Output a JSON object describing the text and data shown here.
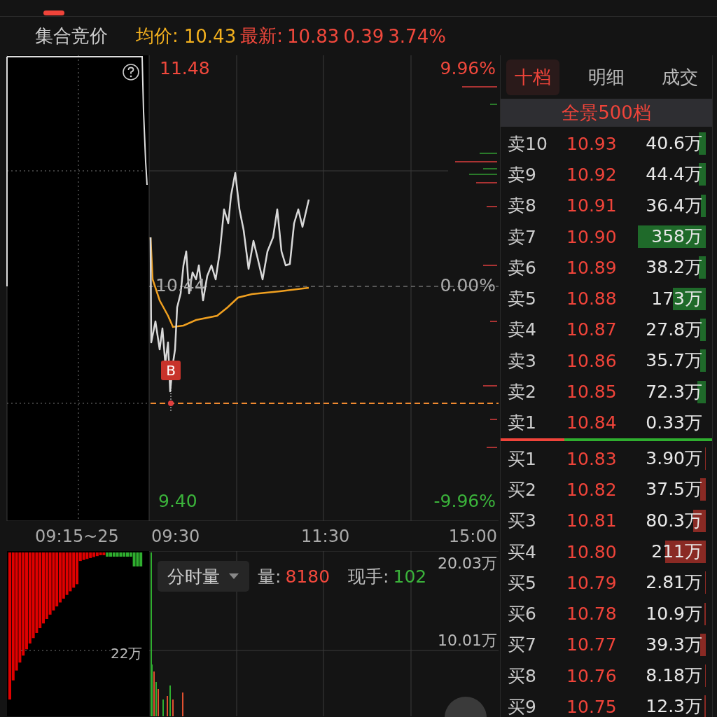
{
  "header": {
    "mode": "集合竞价",
    "avg_label": "均价:",
    "avg_price": "10.43",
    "last_label": "最新:",
    "last_price": "10.83",
    "change": "0.39",
    "change_pct": "3.74%"
  },
  "price_chart": {
    "high": "11.48",
    "high_pct": "9.96%",
    "mid": "10.44",
    "mid_pct": "0.00%",
    "low": "9.40",
    "low_pct": "-9.96%",
    "marker": "B"
  },
  "time_axis": [
    "09:15~25",
    "09:30",
    "11:30",
    "15:00"
  ],
  "volume_chart": {
    "selector": "分时量",
    "volume_label": "量:",
    "volume_value": "8180",
    "hand_label": "现手:",
    "hand_value": "102",
    "top_tick": "20.03万",
    "mid_tick": "10.01万",
    "auction_tick": "22万"
  },
  "order_book": {
    "tabs": [
      {
        "label": "十档",
        "selected": true
      },
      {
        "label": "明细",
        "selected": false
      },
      {
        "label": "成交",
        "selected": false
      }
    ],
    "banner": "全景500档",
    "asks": [
      {
        "label": "卖10",
        "price": "10.93",
        "volume": "40.6万"
      },
      {
        "label": "卖9",
        "price": "10.92",
        "volume": "44.4万"
      },
      {
        "label": "卖8",
        "price": "10.91",
        "volume": "36.4万"
      },
      {
        "label": "卖7",
        "price": "10.90",
        "volume": "358万"
      },
      {
        "label": "卖6",
        "price": "10.89",
        "volume": "38.2万"
      },
      {
        "label": "卖5",
        "price": "10.88",
        "volume": "173万"
      },
      {
        "label": "卖4",
        "price": "10.87",
        "volume": "27.8万"
      },
      {
        "label": "卖3",
        "price": "10.86",
        "volume": "35.7万"
      },
      {
        "label": "卖2",
        "price": "10.85",
        "volume": "72.3万"
      },
      {
        "label": "卖1",
        "price": "10.84",
        "volume": "0.33万"
      }
    ],
    "balance": {
      "level": 0.3
    },
    "bids": [
      {
        "label": "买1",
        "price": "10.83",
        "volume": "3.90万"
      },
      {
        "label": "买2",
        "price": "10.82",
        "volume": "37.5万"
      },
      {
        "label": "买3",
        "price": "10.81",
        "volume": "80.3万"
      },
      {
        "label": "买4",
        "price": "10.80",
        "volume": "211万"
      },
      {
        "label": "买5",
        "price": "10.79",
        "volume": "2.81万"
      },
      {
        "label": "买6",
        "price": "10.78",
        "volume": "10.9万"
      },
      {
        "label": "买7",
        "price": "10.77",
        "volume": "39.3万"
      },
      {
        "label": "买8",
        "price": "10.76",
        "volume": "8.18万"
      },
      {
        "label": "买9",
        "price": "10.75",
        "volume": "12.3万"
      }
    ]
  }
}
